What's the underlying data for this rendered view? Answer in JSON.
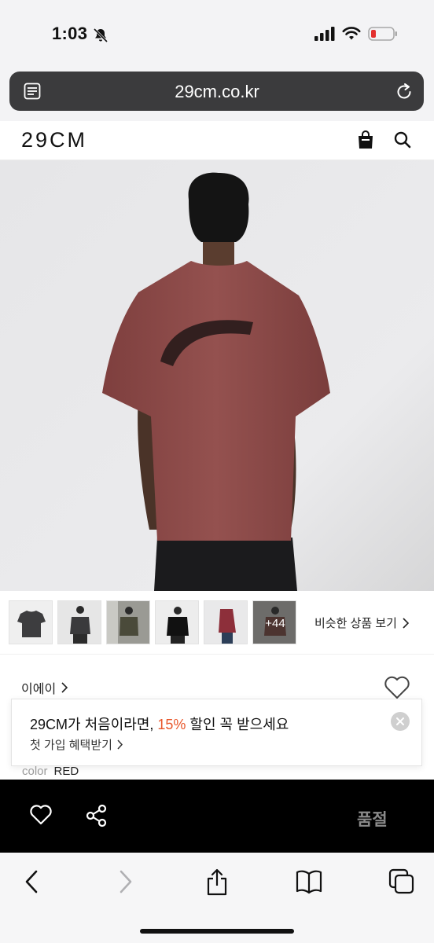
{
  "status": {
    "time": "1:03"
  },
  "browser": {
    "url": "29cm.co.kr"
  },
  "site": {
    "logo": "29CM"
  },
  "thumbnails": {
    "more_label": "+44",
    "similar_label": "비슷한 상품 보기"
  },
  "product": {
    "brand": "이에이",
    "color_label": "color",
    "color_value": "RED",
    "sold_out": "품절"
  },
  "promo": {
    "line1_prefix": "29CM가 처음이라면, ",
    "line1_highlight": "15%",
    "line1_suffix": " 할인 꼭 받으세요",
    "line2": "첫 가입 혜택받기"
  },
  "icons": [
    "bell-slash-icon",
    "signal-icon",
    "wifi-icon",
    "battery-icon",
    "reader-icon",
    "reload-icon",
    "bag-icon",
    "search-icon",
    "heart-icon",
    "share-icon",
    "close-icon",
    "back-icon",
    "forward-icon",
    "share-sheet-icon",
    "bookmarks-icon",
    "tabs-icon"
  ],
  "colors": {
    "accent": "#e8562a",
    "shirt": "#8d4a48",
    "action_bar": "#000000"
  }
}
